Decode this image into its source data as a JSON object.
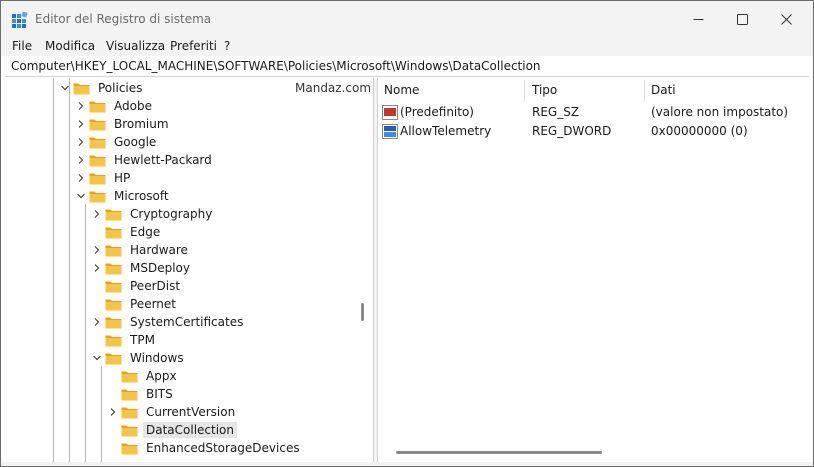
{
  "window": {
    "title": "Editor del Registro di sistema"
  },
  "menu": [
    "File",
    "Modifica",
    "Visualizza",
    "Preferiti",
    "?"
  ],
  "address": "Computer\\HKEY_LOCAL_MACHINE\\SOFTWARE\\Policies\\Microsoft\\Windows\\DataCollection",
  "watermark": "Mandaz.com",
  "tree": [
    {
      "label": "Policies",
      "depth": 0,
      "state": "expanded"
    },
    {
      "label": "Adobe",
      "depth": 1,
      "state": "collapsed"
    },
    {
      "label": "Bromium",
      "depth": 1,
      "state": "collapsed"
    },
    {
      "label": "Google",
      "depth": 1,
      "state": "collapsed"
    },
    {
      "label": "Hewlett-Packard",
      "depth": 1,
      "state": "collapsed"
    },
    {
      "label": "HP",
      "depth": 1,
      "state": "collapsed"
    },
    {
      "label": "Microsoft",
      "depth": 1,
      "state": "expanded"
    },
    {
      "label": "Cryptography",
      "depth": 2,
      "state": "collapsed"
    },
    {
      "label": "Edge",
      "depth": 2,
      "state": "leaf"
    },
    {
      "label": "Hardware",
      "depth": 2,
      "state": "collapsed"
    },
    {
      "label": "MSDeploy",
      "depth": 2,
      "state": "collapsed"
    },
    {
      "label": "PeerDist",
      "depth": 2,
      "state": "leaf"
    },
    {
      "label": "Peernet",
      "depth": 2,
      "state": "leaf"
    },
    {
      "label": "SystemCertificates",
      "depth": 2,
      "state": "collapsed"
    },
    {
      "label": "TPM",
      "depth": 2,
      "state": "leaf"
    },
    {
      "label": "Windows",
      "depth": 2,
      "state": "expanded"
    },
    {
      "label": "Appx",
      "depth": 3,
      "state": "leaf"
    },
    {
      "label": "BITS",
      "depth": 3,
      "state": "leaf"
    },
    {
      "label": "CurrentVersion",
      "depth": 3,
      "state": "collapsed"
    },
    {
      "label": "DataCollection",
      "depth": 3,
      "state": "leaf",
      "selected": true
    },
    {
      "label": "EnhancedStorageDevices",
      "depth": 3,
      "state": "leaf"
    }
  ],
  "list": {
    "columns": [
      "Nome",
      "Tipo",
      "Dati"
    ],
    "rows": [
      {
        "icon": "string-value-icon",
        "name": "(Predefinito)",
        "type": "REG_SZ",
        "data": "(valore non impostato)"
      },
      {
        "icon": "dword-value-icon",
        "name": "AllowTelemetry",
        "type": "REG_DWORD",
        "data": "0x00000000 (0)"
      }
    ]
  },
  "colors": {
    "folder": "#f4c542",
    "folder_dark": "#e0a422",
    "selected_bg": "#e5e5e5",
    "chrome": "#f3f3f3"
  }
}
